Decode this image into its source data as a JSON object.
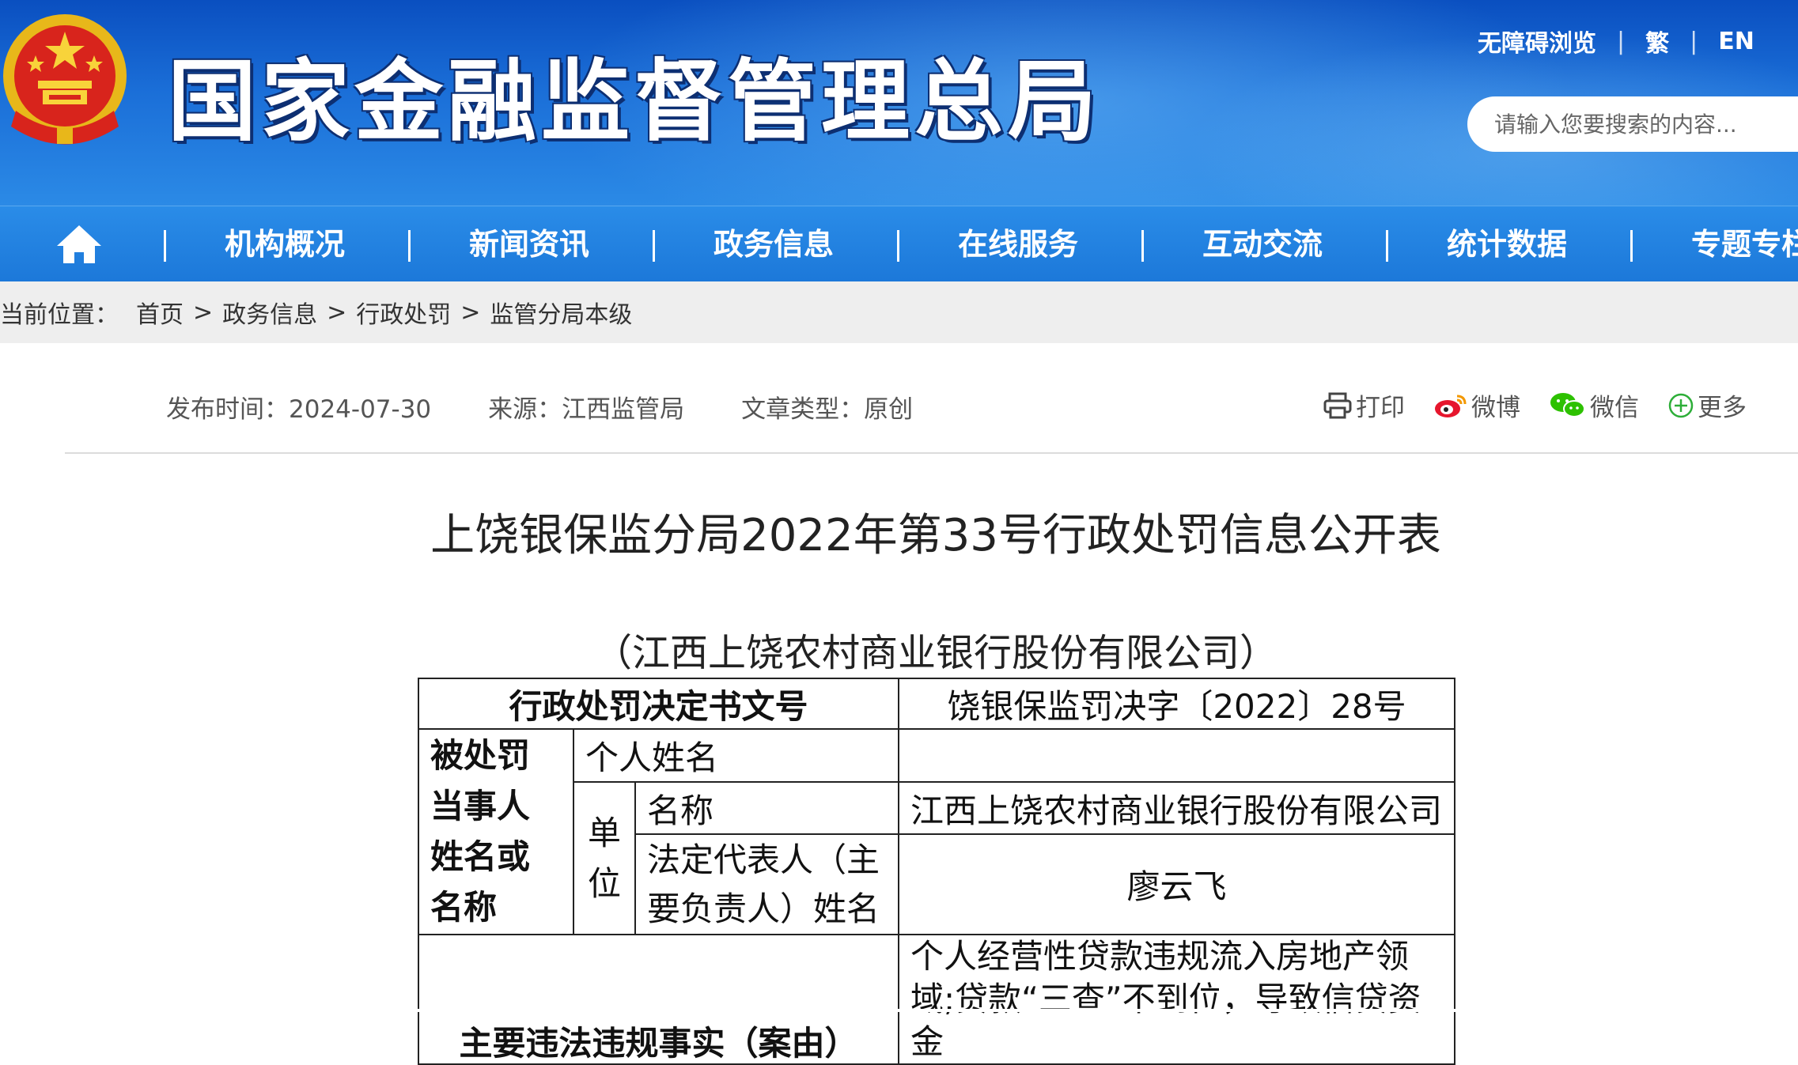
{
  "header": {
    "site_title": "国家金融监督管理总局",
    "top_links": [
      "无障碍浏览",
      "繁",
      "EN"
    ],
    "search_placeholder": "请输入您要搜索的内容..."
  },
  "nav": {
    "home_icon": "home-icon",
    "items": [
      "机构概况",
      "新闻资讯",
      "政务信息",
      "在线服务",
      "互动交流",
      "统计数据",
      "专题专栏"
    ]
  },
  "breadcrumb": {
    "label": "当前位置：",
    "items": [
      "首页",
      "政务信息",
      "行政处罚",
      "监管分局本级"
    ]
  },
  "meta": {
    "publish_time": "发布时间：2024-07-30",
    "source": "来源：江西监管局",
    "type": "文章类型：原创"
  },
  "share": [
    "打印",
    "微博",
    "微信",
    "更多"
  ],
  "article": {
    "title": "上饶银保监分局2022年第33号行政处罚信息公开表",
    "subtitle": "（江西上饶农村商业银行股份有限公司）"
  },
  "table": {
    "decision_no_label": "行政处罚决定书文号",
    "decision_no_value": "饶银保监罚决字〔2022〕28号",
    "party_label": "被处罚当事人姓名或名称",
    "person_name_label": "个人姓名",
    "person_name_value": "",
    "unit_label": "单位",
    "unit_name_label": "名称",
    "unit_name_value": "江西上饶农村商业银行股份有限公司",
    "legal_rep_label": "法定代表人（主要负责人）姓名",
    "legal_rep_value": "廖云飞",
    "facts_label": "主要违法违规事实（案由）",
    "facts_value": "个人经营性贷款违规流入房地产领域;贷款“三查”不到位，导致信贷资金"
  },
  "colors": {
    "header_blue": "#1b6fd8",
    "nav_blue": "#2a8ce8",
    "breadcrumb_bg": "#eeeeee"
  }
}
